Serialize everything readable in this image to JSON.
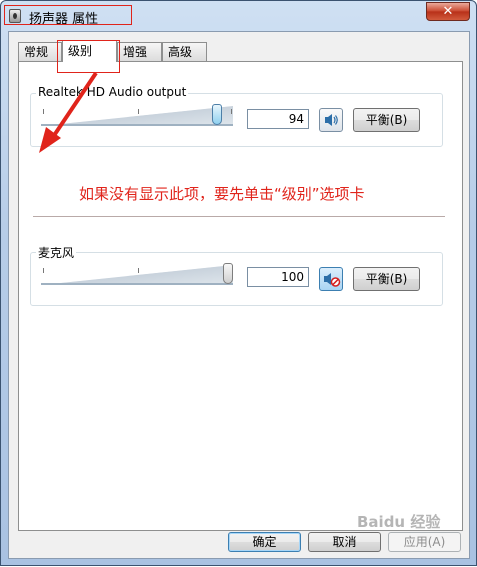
{
  "window": {
    "title": "扬声器 属性",
    "close_symbol": "✕"
  },
  "tabs": [
    {
      "label": "常规",
      "active": false
    },
    {
      "label": "级别",
      "active": true
    },
    {
      "label": "增强",
      "active": false
    },
    {
      "label": "高级",
      "active": false
    }
  ],
  "groups": [
    {
      "label": "Realtek HD Audio output",
      "value": "94",
      "level_percent": 94,
      "muted": false,
      "balance_label": "平衡(B)"
    },
    {
      "label": "麦克风",
      "value": "100",
      "level_percent": 100,
      "muted": true,
      "balance_label": "平衡(B)"
    }
  ],
  "annotation": {
    "text": "如果没有显示此项，要先单击“级别”选项卡",
    "color": "#e0241b"
  },
  "footer": {
    "ok": "确定",
    "cancel": "取消",
    "apply": "应用(A)"
  },
  "watermark": "Baidu 经验",
  "icons": {
    "speaker": "speaker-icon",
    "speaker_muted": "speaker-muted-icon"
  }
}
